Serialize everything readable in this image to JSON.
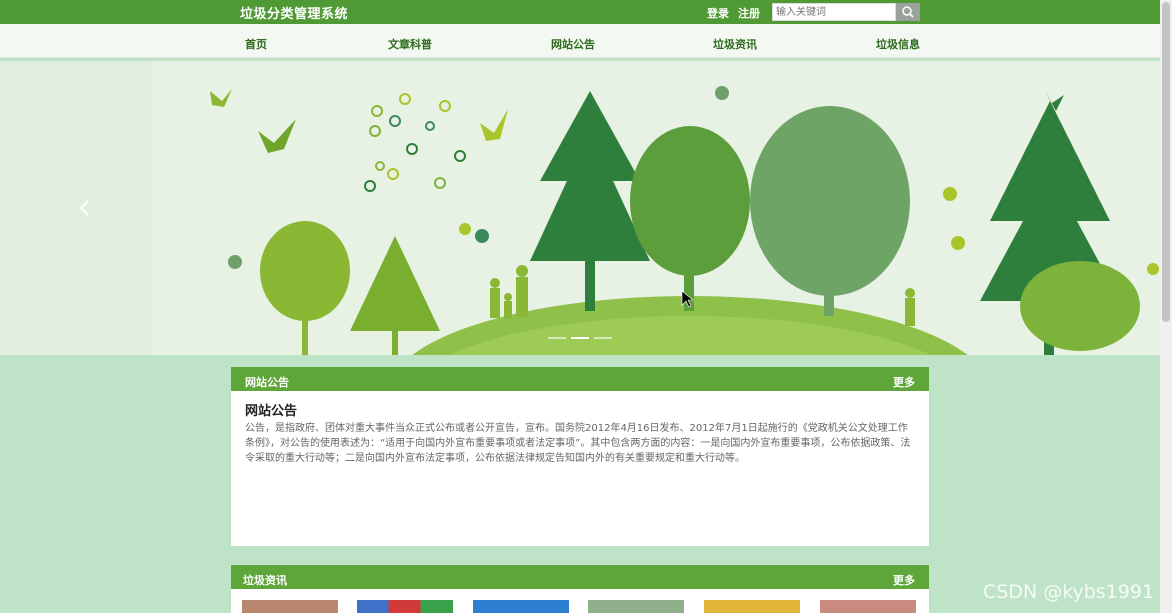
{
  "header": {
    "brand": "垃圾分类管理系统",
    "login": "登录",
    "register": "注册",
    "search_placeholder": "输入关键词",
    "search_icon": "search-icon"
  },
  "nav": {
    "items": [
      {
        "label": "首页"
      },
      {
        "label": "文章科普"
      },
      {
        "label": "网站公告"
      },
      {
        "label": "垃圾资讯"
      },
      {
        "label": "垃圾信息"
      }
    ]
  },
  "banner": {
    "icon_prev": "chevron-left-icon",
    "slide_count": 3,
    "active_slide": 2
  },
  "notice": {
    "header_title": "网站公告",
    "more": "更多",
    "title": "网站公告",
    "text": "公告，是指政府、团体对重大事件当众正式公布或者公开宣告，宣布。国务院2012年4月16日发布、2012年7月1日起施行的《党政机关公文处理工作条例》，对公告的使用表述为：“适用于向国内外宣布重要事项或者法定事项”。其中包含两方面的内容：一是向国内外宣布重要事项，公布依据政策、法令采取的重大行动等；二是向国内外宣布法定事项，公布依据法律规定告知国内外的有关重要规定和重大行动等。"
  },
  "news": {
    "header_title": "垃圾资讯",
    "more": "更多"
  },
  "watermark": "CSDN @kybs1991",
  "colors": {
    "primary_green": "#4f9a34",
    "panel_green": "#5ea53a",
    "page_bg": "#bfe3c7",
    "nav_text": "#2e6b1c"
  }
}
